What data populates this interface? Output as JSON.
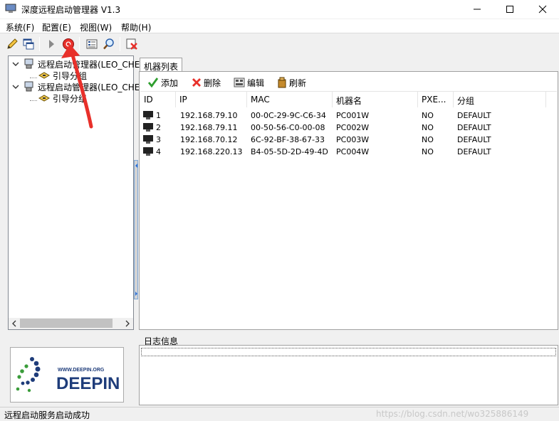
{
  "window": {
    "title": "深度远程启动管理器 V1.3"
  },
  "menu": {
    "items": [
      "系统(F)",
      "配置(E)",
      "视图(W)",
      "帮助(H)"
    ]
  },
  "toolbar": {
    "buttons": [
      "pencil-icon",
      "windows-icon",
      "arrow-right-icon",
      "record-stop-icon",
      "list-icon",
      "search-icon",
      "exit-icon"
    ]
  },
  "tree": {
    "nodes": [
      {
        "label": "远程启动管理器(LEO_CHE"
      },
      {
        "label": "引导分组"
      },
      {
        "label": "远程启动管理器(LEO_CHE"
      },
      {
        "label": "引导分组"
      }
    ]
  },
  "tabs": {
    "machines": "机器列表"
  },
  "panel_toolbar": {
    "add": "添加",
    "delete": "删除",
    "edit": "编辑",
    "refresh": "刷新"
  },
  "table": {
    "columns": [
      "ID",
      "IP",
      "MAC",
      "机器名",
      "PXE...",
      "分组"
    ],
    "rows": [
      {
        "id": "1",
        "ip": "192.168.79.10",
        "mac": "00-0C-29-9C-C6-34",
        "name": "PC001W",
        "pxe": "NO",
        "group": "DEFAULT"
      },
      {
        "id": "2",
        "ip": "192.168.79.11",
        "mac": "00-50-56-C0-00-08",
        "name": "PC002W",
        "pxe": "NO",
        "group": "DEFAULT"
      },
      {
        "id": "3",
        "ip": "192.168.70.12",
        "mac": "6C-92-BF-38-67-33",
        "name": "PC003W",
        "pxe": "NO",
        "group": "DEFAULT"
      },
      {
        "id": "4",
        "ip": "192.168.220.13",
        "mac": "B4-05-5D-2D-49-4D",
        "name": "PC004W",
        "pxe": "NO",
        "group": "DEFAULT"
      }
    ]
  },
  "log": {
    "label": "日志信息"
  },
  "logo": {
    "url_text": "WWW.DEEPIN.ORG",
    "brand": "DEEPIN"
  },
  "status": {
    "text": "远程启动服务启动成功",
    "watermark": "https://blog.csdn.net/wo325886149"
  },
  "colors": {
    "accent_red": "#e8302a",
    "logo_blue": "#1e3c7a",
    "logo_green": "#3a9c3a"
  }
}
